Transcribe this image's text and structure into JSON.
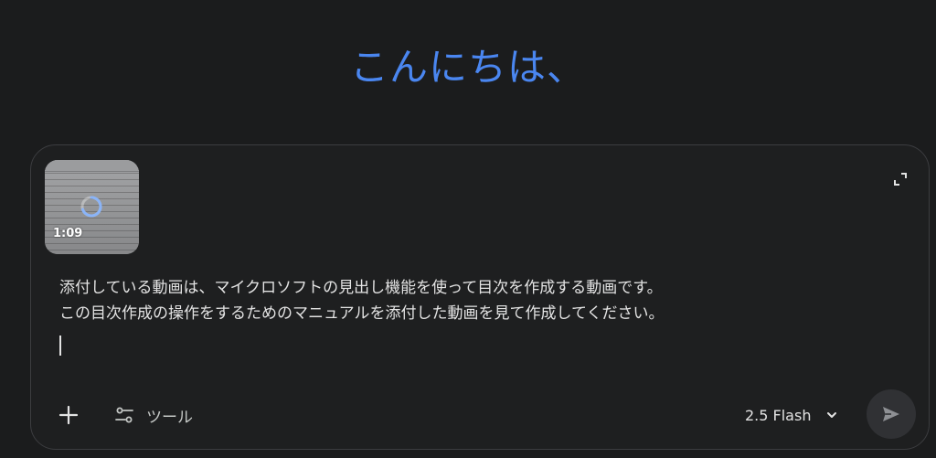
{
  "greeting": "こんにちは、",
  "attachment": {
    "type": "video",
    "duration": "1:09",
    "loading": true
  },
  "prompt": {
    "lines": [
      "添付している動画は、マイクロソフトの見出し機能を使って目次を作成する動画です。",
      "この目次作成の操作をするためのマニュアルを添付した動画を見て作成してください。"
    ]
  },
  "toolbar": {
    "add_icon": "plus-icon",
    "tools_icon": "tune-icon",
    "tools_label": "ツール",
    "model_label": "2.5 Flash",
    "model_icon": "chevron-down-icon",
    "send_icon": "send-icon",
    "expand_icon": "expand-icon"
  },
  "colors": {
    "background": "#1b1c1d",
    "greeting": "#4a86f0",
    "text": "#e3e3e3",
    "send_button_bg": "#303134"
  }
}
